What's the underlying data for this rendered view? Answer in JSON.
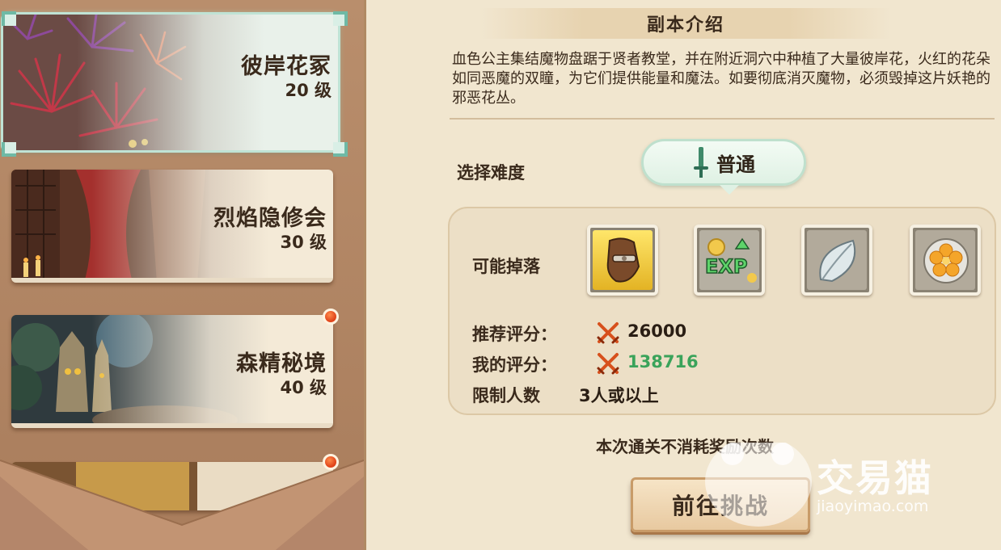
{
  "dungeons": [
    {
      "name": "彼岸花冢",
      "level": "20 级",
      "selected": true
    },
    {
      "name": "烈焰隐修会",
      "level": "30 级"
    },
    {
      "name": "森精秘境",
      "level": "40 级",
      "badge": true
    }
  ],
  "detail": {
    "header": "副本介绍",
    "description": "血色公主集结魔物盘踞于贤者教堂，并在附近洞穴中种植了大量彼岸花，火红的花朵如同恶魔的双瞳，为它们提供能量和魔法。如要彻底消灭魔物，必须毁掉这片妖艳的邪恶花丛。",
    "difficulty_label": "选择难度",
    "difficulty_value": "普通",
    "drops_label": "可能掉落",
    "drops": [
      {
        "icon": "gauntlet-icon",
        "rarity": "gold"
      },
      {
        "icon": "exp-icon"
      },
      {
        "icon": "leaf-icon"
      },
      {
        "icon": "flower-coin-icon"
      }
    ],
    "recommended_label": "推荐评分：",
    "recommended_value": "26000",
    "my_label": "我的评分：",
    "my_value": "138716",
    "limit_label": "限制人数",
    "limit_value": "3人或以上",
    "note": "本次通关不消耗奖励次数",
    "challenge_button": "前往挑战"
  },
  "watermark": {
    "text": "交易猫",
    "url": "jiaoyimao.com"
  },
  "colors": {
    "accent_green": "#3aa35a",
    "score_icon": "#d7501c",
    "selected_glow": "#bfe3d5"
  }
}
